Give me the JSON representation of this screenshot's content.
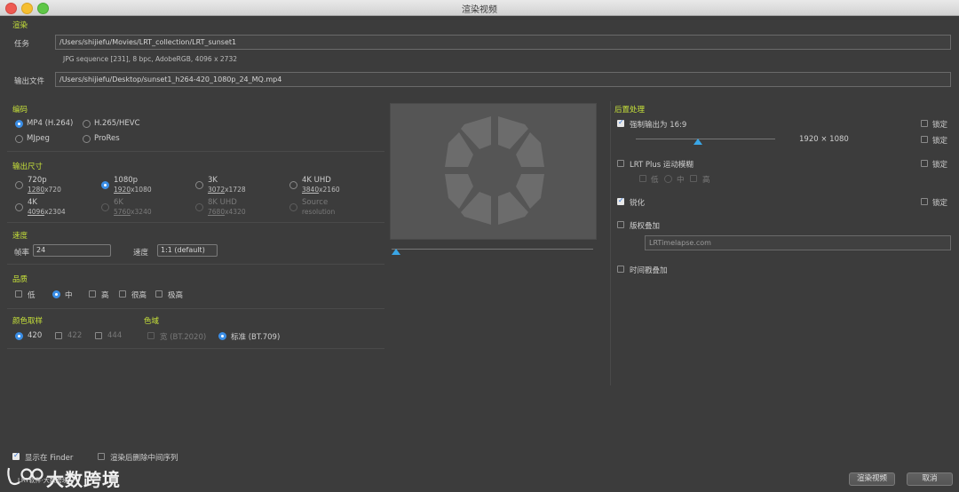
{
  "window": {
    "title": "渲染视频"
  },
  "render": {
    "section": "渲染",
    "task_label": "任务",
    "task_value": "/Users/shijiefu/Movies/LRT_collection/LRT_sunset1",
    "task_info": "JPG sequence [231], 8 bpc, AdobeRGB, 4096 x 2732",
    "output_label": "输出文件",
    "output_value": "/Users/shijiefu/Desktop/sunset1_h264-420_1080p_24_MQ.mp4"
  },
  "encoding": {
    "section": "编码",
    "options": [
      "MP4 (H.264)",
      "H.265/HEVC",
      "MJpeg",
      "ProRes"
    ],
    "selected": "MP4 (H.264)"
  },
  "output_size": {
    "section": "输出尺寸",
    "options": [
      {
        "name": "720p",
        "res": "1280x720"
      },
      {
        "name": "1080p",
        "res": "1920x1080"
      },
      {
        "name": "3K",
        "res": "3072x1728"
      },
      {
        "name": "4K UHD",
        "res": "3840x2160"
      },
      {
        "name": "4K",
        "res": "4096x2304"
      },
      {
        "name": "6K",
        "res": "5760x3240"
      },
      {
        "name": "8K UHD",
        "res": "7680x4320"
      },
      {
        "name": "Source",
        "res": "resolution"
      }
    ],
    "selected": "1080p"
  },
  "speed": {
    "section": "速度",
    "fps_label": "帧率",
    "fps_value": "24",
    "rate_label": "速度",
    "rate_value": "1:1 (default)"
  },
  "quality": {
    "section": "品质",
    "options": [
      "低",
      "中",
      "高",
      "很高",
      "极高"
    ],
    "selected": "中"
  },
  "color_sampling": {
    "section": "颜色取样",
    "options": [
      "420",
      "422",
      "444"
    ],
    "selected": "420"
  },
  "gamut": {
    "section": "色域",
    "options": [
      "宽 (BT.2020)",
      "标准 (BT.709)"
    ],
    "selected": "标准 (BT.709)"
  },
  "post": {
    "section": "后置处理",
    "force_169_label": "强制输出为 16:9",
    "force_169_checked": true,
    "resolution_text": "1920 × 1080",
    "lock_label": "锁定",
    "motion_blur_label": "LRT Plus 运动模糊",
    "blur_levels": [
      "低",
      "中",
      "高"
    ],
    "blur_selected": "中",
    "sharpen_label": "锐化",
    "sharpen_checked": true,
    "copyright_label": "版权叠加",
    "copyright_value": "LRTimelapse.com",
    "timestamp_label": "时间戳叠加"
  },
  "footer": {
    "show_finder_label": "显示在 Finder",
    "show_finder_checked": true,
    "delete_seq_label": "渲染后删除中间序列",
    "delete_seq_checked": false,
    "render_button": "渲染视频",
    "cancel_button": "取消"
  },
  "watermark": {
    "text": "大数跨境",
    "small": "LRT软件·大数跨境"
  }
}
